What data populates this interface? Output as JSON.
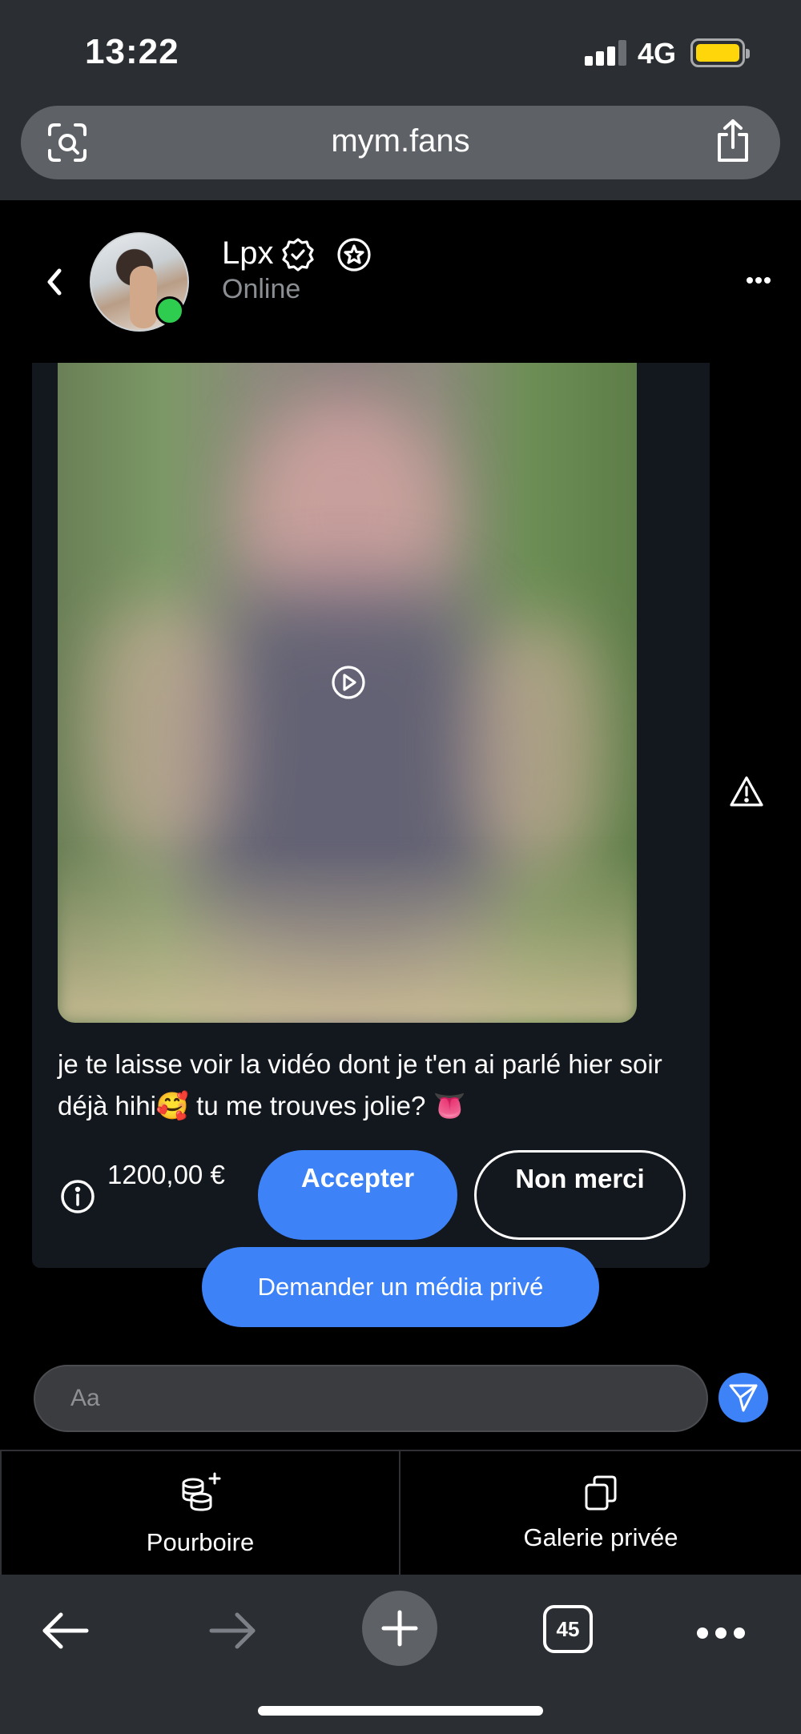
{
  "status_bar": {
    "time": "13:22",
    "network": "4G"
  },
  "browser": {
    "url": "mym.fans"
  },
  "chat_header": {
    "name": "Lpx",
    "status": "Online"
  },
  "message": {
    "text": "je te laisse voir la vidéo dont je t'en ai parlé hier soir déjà hihi🥰 tu me trouves jolie? 👅",
    "price": "1200,00 €",
    "accept_label": "Accepter",
    "decline_label": "Non merci"
  },
  "request_media_label": "Demander un média privé",
  "composer": {
    "placeholder": "Aa"
  },
  "bottom_tabs": {
    "tip_label": "Pourboire",
    "gallery_label": "Galerie privée"
  },
  "safari_toolbar": {
    "tab_count": "45"
  },
  "colors": {
    "accent": "#3d82f6",
    "online": "#2ecc4f",
    "battery": "#ffd60a"
  }
}
